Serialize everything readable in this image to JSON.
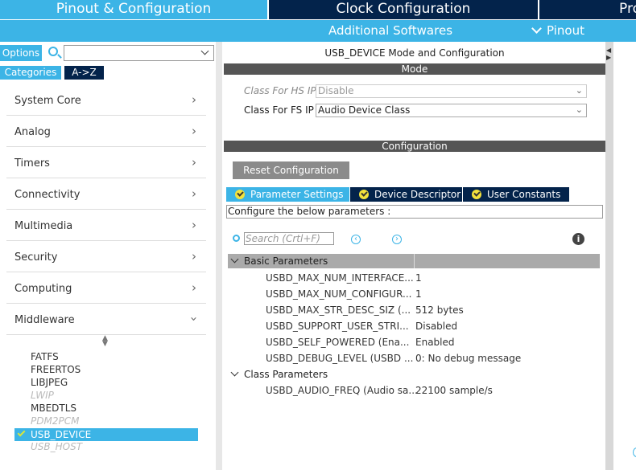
{
  "tabs": {
    "pinout": "Pinout & Configuration",
    "clock": "Clock Configuration",
    "pro": "Pro"
  },
  "subbar": {
    "additional": "Additional Softwares",
    "pinout": "Pinout"
  },
  "left": {
    "options": "Options",
    "search_placeholder": "",
    "categories": "Categories",
    "atoz": "A->Z",
    "menu": [
      "System Core",
      "Analog",
      "Timers",
      "Connectivity",
      "Multimedia",
      "Security",
      "Computing",
      "Middleware"
    ],
    "middleware_items": [
      {
        "label": "FATFS",
        "enabled": true
      },
      {
        "label": "FREERTOS",
        "enabled": true
      },
      {
        "label": "LIBJPEG",
        "enabled": true
      },
      {
        "label": "LWIP",
        "enabled": false
      },
      {
        "label": "MBEDTLS",
        "enabled": true
      },
      {
        "label": "PDM2PCM",
        "enabled": false
      },
      {
        "label": "USB_DEVICE",
        "enabled": true,
        "selected": true
      },
      {
        "label": "USB_HOST",
        "enabled": false
      }
    ]
  },
  "mode": {
    "title": "USB_DEVICE Mode and Configuration",
    "header": "Mode",
    "hs_label": "Class For HS IP",
    "hs_value": "Disable",
    "fs_label": "Class For FS IP",
    "fs_value": "Audio Device Class"
  },
  "config": {
    "header": "Configuration",
    "reset": "Reset Configuration",
    "tabs": [
      "Parameter Settings",
      "Device Descriptor",
      "User Constants"
    ],
    "configure_text": "Configure the below parameters :",
    "search_placeholder": "Search (Crtl+F)",
    "basic_group": "Basic Parameters",
    "basic_params": [
      {
        "name": "USBD_MAX_NUM_INTERFACE...",
        "value": "1"
      },
      {
        "name": "USBD_MAX_NUM_CONFIGUR...",
        "value": "1"
      },
      {
        "name": "USBD_MAX_STR_DESC_SIZ (...",
        "value": "512 bytes"
      },
      {
        "name": "USBD_SUPPORT_USER_STRI...",
        "value": "Disabled"
      },
      {
        "name": "USBD_SELF_POWERED (Ena...",
        "value": "Enabled"
      },
      {
        "name": "USBD_DEBUG_LEVEL (USBD ...",
        "value": "0: No debug message"
      }
    ],
    "class_group": "Class Parameters",
    "class_params": [
      {
        "name": "USBD_AUDIO_FREQ (Audio sa...",
        "value": "22100 sample/s"
      }
    ]
  },
  "colors": {
    "accent": "#3cb4e6",
    "dark": "#03234b",
    "header_gray": "#555555"
  }
}
